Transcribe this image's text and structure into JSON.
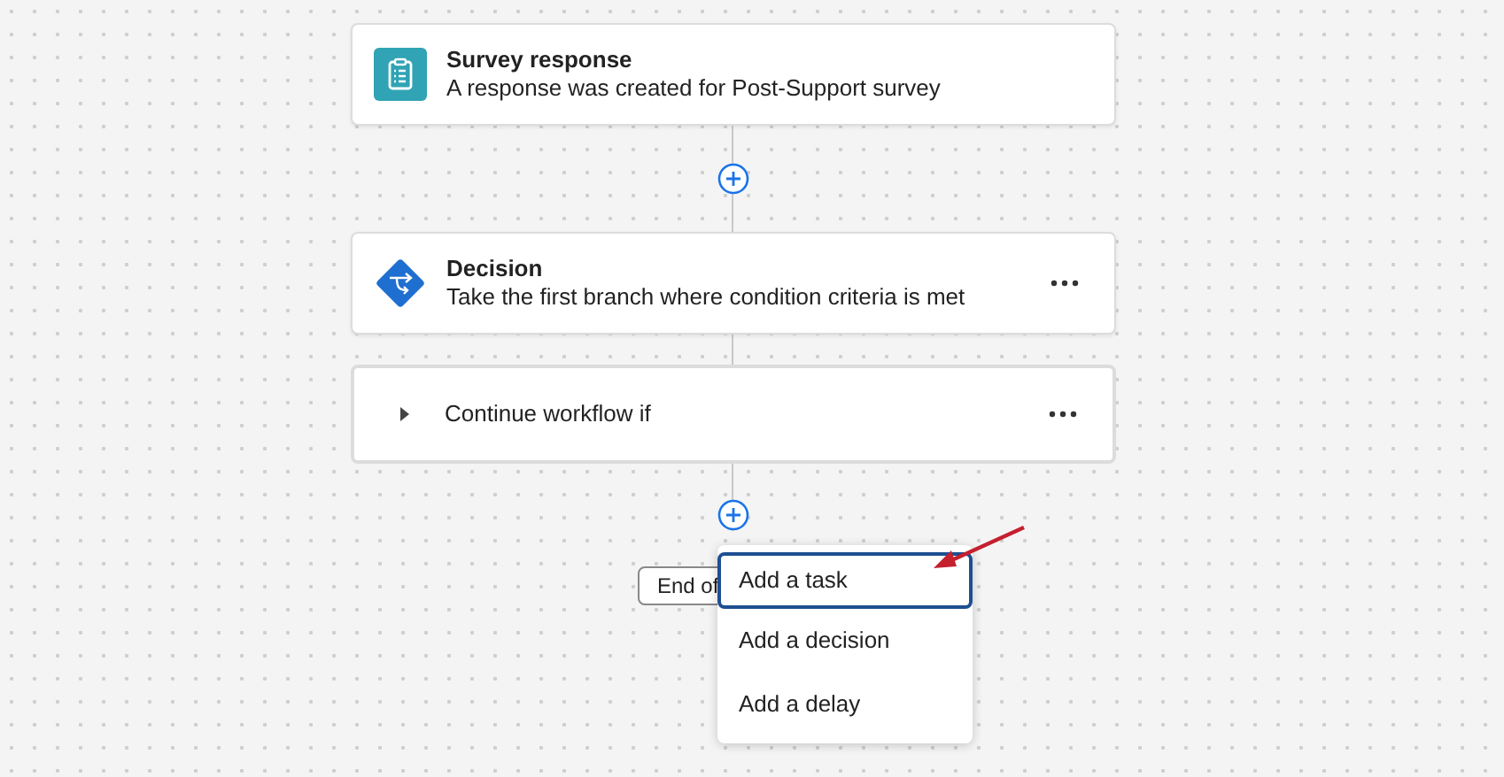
{
  "steps": [
    {
      "kind": "trigger",
      "title": "Survey response",
      "description": "A response was created for Post-Support survey",
      "has_menu": false
    },
    {
      "kind": "decision",
      "title": "Decision",
      "description": "Take the first branch where condition criteria is met",
      "has_menu": true
    },
    {
      "kind": "branch",
      "title": "Continue workflow if",
      "expanded": false,
      "has_menu": true
    }
  ],
  "end_button": {
    "label": "End of"
  },
  "add_menu": [
    {
      "label": "Add a task",
      "selected": true
    },
    {
      "label": "Add a decision",
      "selected": false
    },
    {
      "label": "Add a delay",
      "selected": false
    }
  ]
}
